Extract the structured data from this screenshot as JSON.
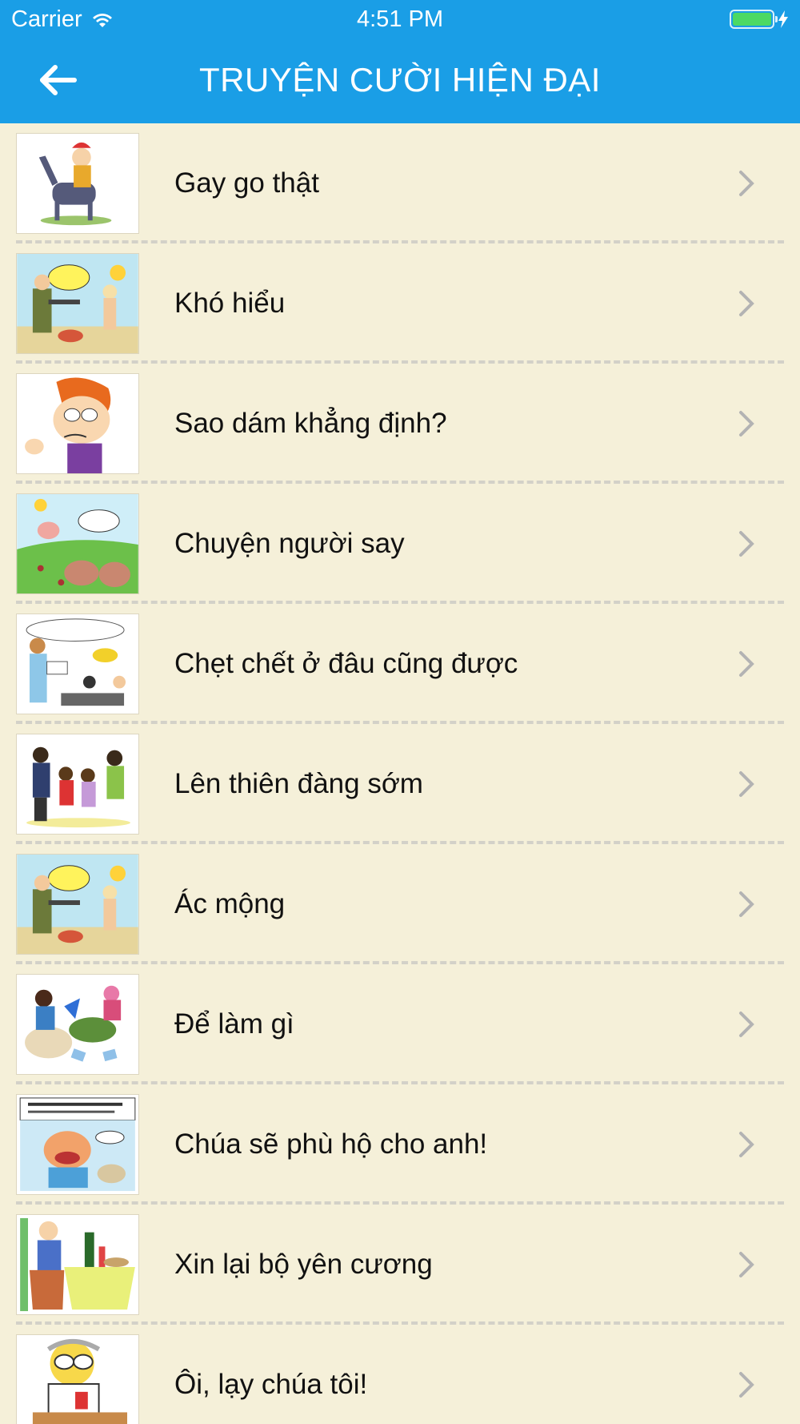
{
  "status_bar": {
    "carrier": "Carrier",
    "time": "4:51 PM",
    "battery_color": "#4cd964"
  },
  "nav": {
    "title": "TRUYỆN CƯỜI HIỆN ĐẠI",
    "back_icon": "arrow-left-icon",
    "background_color": "#1a9ee6"
  },
  "list": {
    "background_color": "#f5f0d9",
    "items": [
      {
        "title": "Gay go thật",
        "thumbnail": "cartoon-donkey-rider"
      },
      {
        "title": "Khó hiểu",
        "thumbnail": "cartoon-soldier-beach"
      },
      {
        "title": "Sao dám khẳng định?",
        "thumbnail": "cartoon-redhead-boy"
      },
      {
        "title": "Chuyện người say",
        "thumbnail": "cartoon-pigs-field"
      },
      {
        "title": "Chẹt chết ở đâu cũng được",
        "thumbnail": "cartoon-classroom"
      },
      {
        "title": "Lên thiên đàng sớm",
        "thumbnail": "cartoon-family"
      },
      {
        "title": "Ác mộng",
        "thumbnail": "cartoon-soldier-beach"
      },
      {
        "title": "Để làm gì",
        "thumbnail": "cartoon-chaos"
      },
      {
        "title": "Chúa sẽ phù hộ cho anh!",
        "thumbnail": "cartoon-fat-man"
      },
      {
        "title": "Xin lại bộ yên cương",
        "thumbnail": "cartoon-table-dinner"
      },
      {
        "title": "Ôi, lạy chúa tôi!",
        "thumbnail": "cartoon-old-man"
      }
    ]
  }
}
